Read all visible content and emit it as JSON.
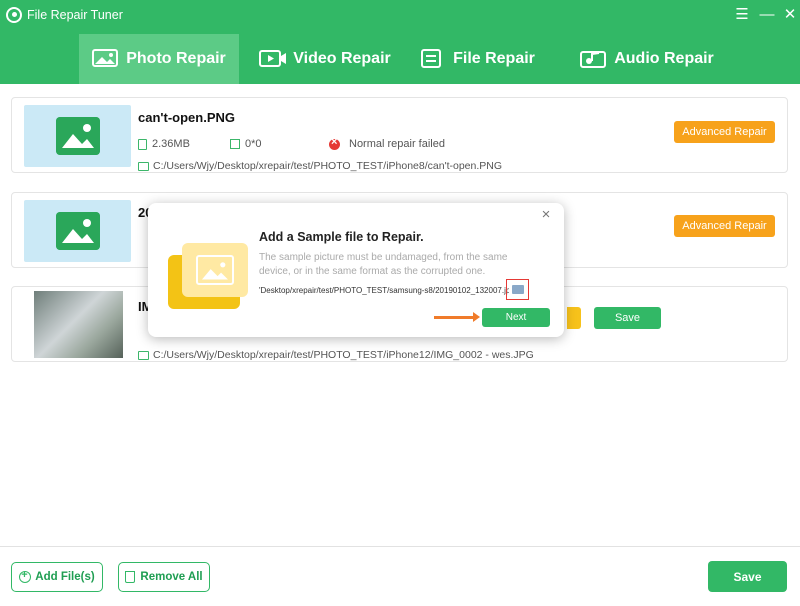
{
  "app": {
    "title": "File Repair Tuner"
  },
  "window": {
    "menu_glyph": "☰",
    "min_glyph": "—",
    "close_glyph": "✕"
  },
  "tabs": [
    {
      "label": "Photo Repair",
      "icon": "photo-icon",
      "active": true
    },
    {
      "label": "Video Repair",
      "icon": "video-icon",
      "active": false
    },
    {
      "label": "File Repair",
      "icon": "file-icon",
      "active": false
    },
    {
      "label": "Audio Repair",
      "icon": "audio-icon",
      "active": false
    }
  ],
  "files": [
    {
      "name": "can't-open.PNG",
      "size": "2.36MB",
      "dimensions": "0*0",
      "status": "Normal repair failed",
      "path": "C:/Users/Wjy/Desktop/xrepair/test/PHOTO_TEST/iPhone8/can't-open.PNG",
      "action": "Advanced Repair"
    },
    {
      "name_visible": "20",
      "action": "Advanced Repair"
    },
    {
      "name_visible": "IMG",
      "path": "C:/Users/Wjy/Desktop/xrepair/test/PHOTO_TEST/iPhone12/IMG_0002 - wes.JPG",
      "action": "Save"
    }
  ],
  "bottom": {
    "add_label": "Add File(s)",
    "remove_label": "Remove All",
    "save_label": "Save"
  },
  "modal": {
    "title": "Add a Sample file to Repair.",
    "description": "The sample picture must be undamaged, from the same device, or in the same format as the corrupted one.",
    "path_value": "'Desktop/xrepair/test/PHOTO_TEST/samsung-s8/20190102_132007.jpg",
    "next_label": "Next",
    "close_glyph": "×"
  },
  "colors": {
    "brand_green": "#32b866",
    "active_tab": "#5ccb86",
    "advanced_orange": "#f7a21b",
    "error_red": "#e53935",
    "arrow_orange": "#f07b2a"
  }
}
